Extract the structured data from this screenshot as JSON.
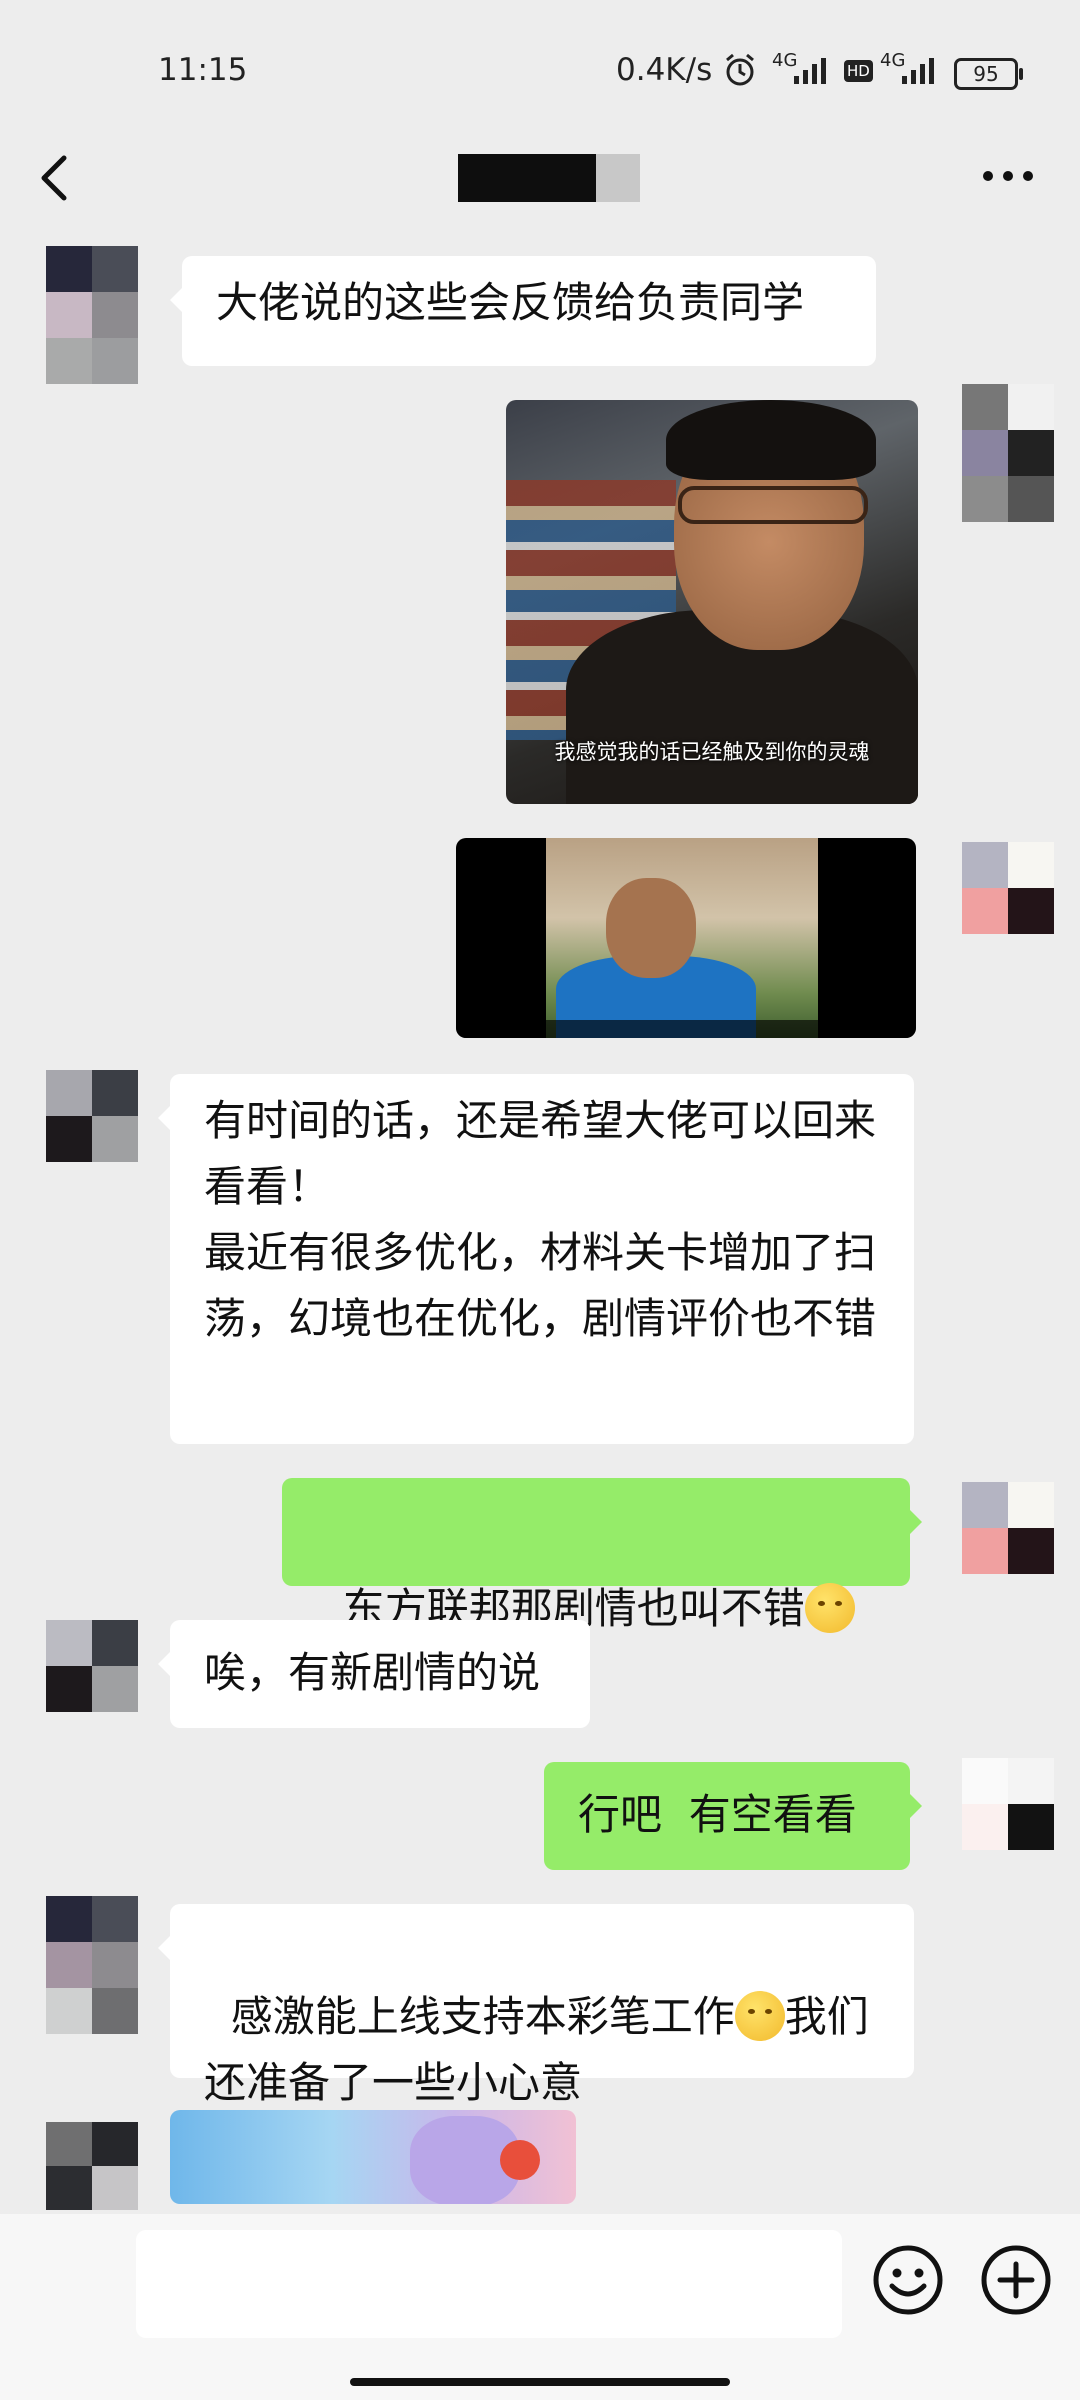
{
  "status_bar": {
    "time": "11:15",
    "net_speed": "0.4K/s",
    "alarm_icon": "alarm-icon",
    "signal1_label": "4G",
    "hd_label": "HD",
    "signal2_label": "4G",
    "battery": "95"
  },
  "nav": {
    "back_icon": "chevron-left-icon",
    "more_icon": "more-horizontal-icon"
  },
  "messages": {
    "m1": "大佬说的这些会反馈给负责同学",
    "img_caption": "我感觉我的话已经触及到你的灵魂",
    "m2": "有时间的话，还是希望大佬可以回来看看！\n最近有很多优化，材料关卡增加了扫荡，幻境也在优化，剧情评价也不错",
    "m3": "东方联邦那剧情也叫不错",
    "m4": "唉，有新剧情的说",
    "m5": "行吧  有空看看",
    "m6_before_emoji": "感激能上线支持本彩笔工作",
    "m6_after_emoji": "我们还准备了一些小心意"
  },
  "input_bar": {
    "emoji_button_icon": "emoji-face-icon",
    "plus_button_icon": "plus-circle-icon"
  }
}
